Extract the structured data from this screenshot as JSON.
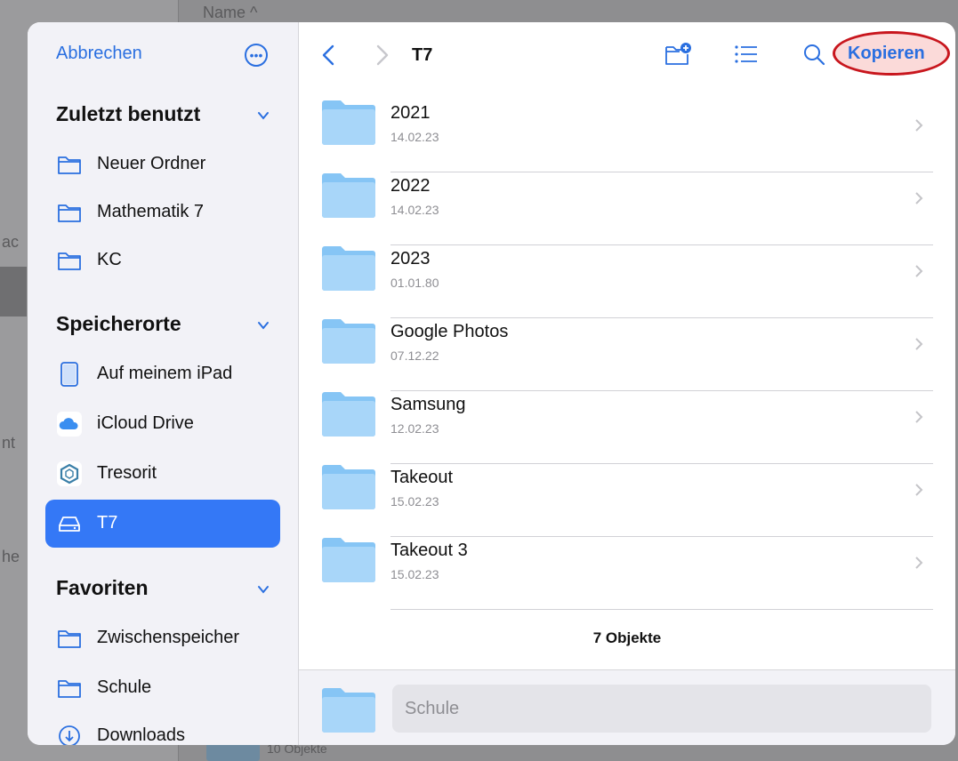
{
  "background": {
    "header_text": "Name ^",
    "footer_text": "10 Objekte",
    "edge_texts": [
      "ac",
      "nt",
      "he"
    ]
  },
  "sidebar": {
    "cancel_label": "Abbrechen",
    "more_icon": "ellipsis-circle-icon",
    "sections": [
      {
        "title": "Zuletzt benutzt",
        "items": [
          {
            "label": "Neuer Ordner",
            "icon": "folder-icon"
          },
          {
            "label": "Mathematik 7",
            "icon": "folder-icon"
          },
          {
            "label": "KC",
            "icon": "folder-icon"
          }
        ]
      },
      {
        "title": "Speicherorte",
        "items": [
          {
            "label": "Auf meinem iPad",
            "icon": "ipad-icon"
          },
          {
            "label": "iCloud Drive",
            "icon": "icloud-icon"
          },
          {
            "label": "Tresorit",
            "icon": "tresorit-icon"
          },
          {
            "label": "T7",
            "icon": "external-drive-icon",
            "selected": true
          }
        ]
      },
      {
        "title": "Favoriten",
        "items": [
          {
            "label": "Zwischenspeicher",
            "icon": "folder-icon"
          },
          {
            "label": "Schule",
            "icon": "folder-icon"
          },
          {
            "label": "Downloads",
            "icon": "download-icon"
          }
        ]
      }
    ]
  },
  "toolbar": {
    "title": "T7",
    "copy_label": "Kopieren"
  },
  "files": [
    {
      "name": "2021",
      "date": "14.02.23"
    },
    {
      "name": "2022",
      "date": "14.02.23"
    },
    {
      "name": "2023",
      "date": "01.01.80"
    },
    {
      "name": "Google Photos",
      "date": "07.12.22"
    },
    {
      "name": "Samsung",
      "date": "12.02.23"
    },
    {
      "name": "Takeout",
      "date": "15.02.23"
    },
    {
      "name": "Takeout 3",
      "date": "15.02.23"
    }
  ],
  "footer": {
    "count": "7 Objekte",
    "destination_value": "Schule"
  },
  "colors": {
    "accent": "#3478f6",
    "highlight_ring": "#c8161d",
    "folder": "#86c5f5"
  }
}
